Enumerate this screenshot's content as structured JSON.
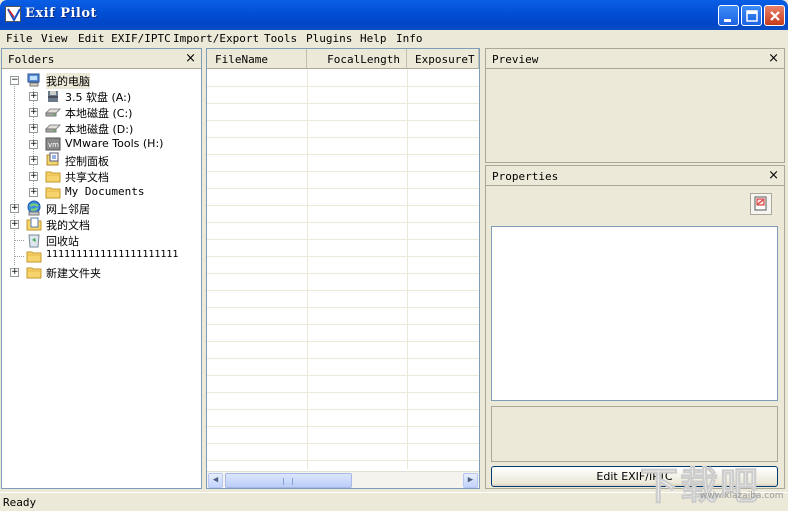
{
  "window": {
    "title": "Exif Pilot"
  },
  "menu": [
    "File",
    "View",
    "Edit EXIF/IPTC",
    "Import/Export",
    "Tools",
    "Plugins",
    "Help",
    "Info"
  ],
  "folders": {
    "title": "Folders",
    "close": "×",
    "tree": [
      {
        "label": "我的电脑",
        "icon": "my-computer-icon",
        "expander": "−"
      },
      {
        "label": "3.5 软盘 (A:)",
        "icon": "floppy-drive-icon",
        "expander": "+"
      },
      {
        "label": "本地磁盘 (C:)",
        "icon": "hard-disk-icon",
        "expander": "+"
      },
      {
        "label": "本地磁盘 (D:)",
        "icon": "hard-disk-icon",
        "expander": "+"
      },
      {
        "label": "VMware Tools (H:)",
        "icon": "vmware-drive-icon",
        "expander": "+"
      },
      {
        "label": "控制面板",
        "icon": "control-panel-icon",
        "expander": "+"
      },
      {
        "label": "共享文档",
        "icon": "folder-icon",
        "expander": "+"
      },
      {
        "label": "My Documents",
        "icon": "folder-icon",
        "expander": "+"
      },
      {
        "label": "网上邻居",
        "icon": "network-places-icon",
        "expander": "+"
      },
      {
        "label": "我的文档",
        "icon": "my-documents-icon",
        "expander": "+"
      },
      {
        "label": "回收站",
        "icon": "recycle-bin-icon",
        "expander": ""
      },
      {
        "label": "1111111111111111111111",
        "icon": "folder-icon",
        "expander": ""
      },
      {
        "label": "新建文件夹",
        "icon": "folder-icon",
        "expander": "+"
      }
    ]
  },
  "filelist": {
    "columns": [
      "FileName",
      "FocalLength",
      "ExposureT"
    ]
  },
  "preview": {
    "title": "Preview",
    "close": "×"
  },
  "properties": {
    "title": "Properties",
    "close": "×",
    "edit_button": "Edit EXIF/IPTC"
  },
  "status": {
    "text": "Ready"
  },
  "watermark": {
    "text": "下载吧",
    "sub": "www.xiazaiba.com"
  }
}
